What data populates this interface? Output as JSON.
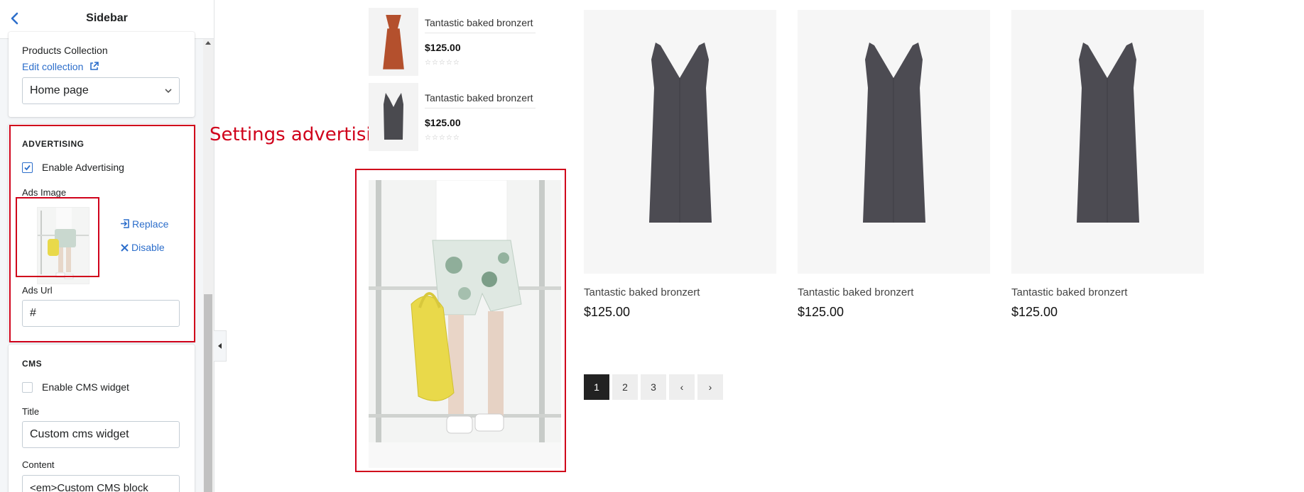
{
  "sidebar": {
    "title": "Sidebar",
    "products": {
      "label": "Products Collection",
      "edit_link": "Edit collection",
      "selected": "Home page"
    },
    "advertising": {
      "heading": "ADVERTISING",
      "enable_label": "Enable Advertising",
      "enabled": true,
      "image_label": "Ads Image",
      "replace_label": "Replace",
      "disable_label": "Disable",
      "url_label": "Ads Url",
      "url_value": "#"
    },
    "cms": {
      "heading": "CMS",
      "enable_label": "Enable CMS widget",
      "enabled": false,
      "title_label": "Title",
      "title_value": "Custom cms widget",
      "content_label": "Content",
      "content_value": "<em>Custom CMS block"
    }
  },
  "annotation": {
    "text": "Settings advertising",
    "color": "#d0021b"
  },
  "storefront": {
    "mini_products": [
      {
        "name": "Tantastic baked bronzert",
        "price": "$125.00",
        "color": "#b4502d"
      },
      {
        "name": "Tantastic baked bronzert",
        "price": "$125.00",
        "color": "#4a4a4f"
      }
    ],
    "stars": "☆☆☆☆☆",
    "products": [
      {
        "name": "Tantastic baked bronzert",
        "price": "$125.00"
      },
      {
        "name": "Tantastic baked bronzert",
        "price": "$125.00"
      },
      {
        "name": "Tantastic baked bronzert",
        "price": "$125.00"
      }
    ],
    "pagination": {
      "pages": [
        "1",
        "2",
        "3"
      ],
      "current": "1",
      "prev": "‹",
      "next": "›"
    }
  },
  "colors": {
    "accent": "#2c6ecb",
    "dress": "#4c4b52",
    "backpack": "#e9d94a"
  }
}
